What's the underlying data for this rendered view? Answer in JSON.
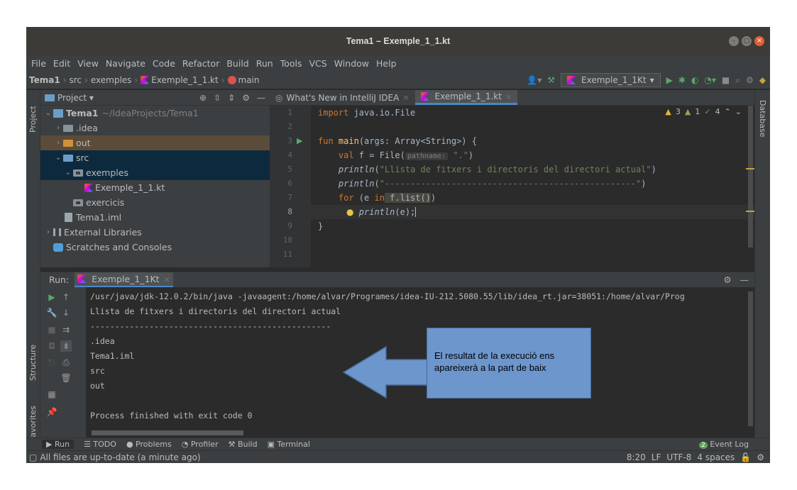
{
  "window": {
    "title": "Tema1 – Exemple_1_1.kt"
  },
  "menu": [
    "File",
    "Edit",
    "View",
    "Navigate",
    "Code",
    "Refactor",
    "Build",
    "Run",
    "Tools",
    "VCS",
    "Window",
    "Help"
  ],
  "breadcrumb": [
    "Tema1",
    "src",
    "exemples",
    "Exemple_1_1.kt",
    "main"
  ],
  "toolbar": {
    "run_config": "Exemple_1_1Kt"
  },
  "left_strip": {
    "project": "Project",
    "structure": "Structure",
    "favorites": "Favorites"
  },
  "right_strip": {
    "database": "Database"
  },
  "project_panel": {
    "title": "Project",
    "tree": [
      {
        "label": "Tema1",
        "suffix": "~/IdeaProjects/Tema1"
      },
      {
        "label": ".idea"
      },
      {
        "label": "out"
      },
      {
        "label": "src"
      },
      {
        "label": "exemples"
      },
      {
        "label": "Exemple_1_1.kt"
      },
      {
        "label": "exercicis"
      },
      {
        "label": "Tema1.iml"
      },
      {
        "label": "External Libraries"
      },
      {
        "label": "Scratches and Consoles"
      }
    ]
  },
  "editor": {
    "tabs": [
      {
        "label": "What's New in IntelliJ IDEA"
      },
      {
        "label": "Exemple_1_1.kt"
      }
    ],
    "inspections": {
      "warn_a": "3",
      "warn_b": "1",
      "typo": "4"
    },
    "line_numbers": [
      "1",
      "2",
      "3",
      "4",
      "5",
      "6",
      "7",
      "8",
      "9",
      "10",
      "11"
    ],
    "code": {
      "l1_kw": "import",
      "l1_rest": " java.io.File",
      "l3_kw": "fun",
      "l3_fn": " main",
      "l3_rest": "(args: Array<String>) {",
      "l4_kw": "    val",
      "l4_a": " f = File(",
      "l4_hint": "pathname:",
      "l4_str": " \".\"",
      "l4_b": ")",
      "l5_fn": "    println",
      "l5_a": "(",
      "l5_str": "\"Llista de fitxers i directoris del directori actual\"",
      "l5_b": ")",
      "l6_fn": "    println",
      "l6_a": "(",
      "l6_str": "\"-------------------------------------------------\"",
      "l6_b": ")",
      "l7_kw": "    for",
      "l7_a": " (e ",
      "l7_kw2": "in",
      "l7_hl": " f.list()",
      "l7_b": ")",
      "l8_fn": "        println",
      "l8_a": "(e);",
      "l9": "}"
    }
  },
  "run_panel": {
    "label": "Run:",
    "tab": "Exemple_1_1Kt",
    "output": [
      "/usr/java/jdk-12.0.2/bin/java -javaagent:/home/alvar/Programes/idea-IU-212.5080.55/lib/idea_rt.jar=38051:/home/alvar/Prog",
      "Llista de fitxers i directoris del directori actual",
      "-------------------------------------------------",
      ".idea",
      "Tema1.iml",
      "src",
      "out",
      "",
      "Process finished with exit code 0"
    ]
  },
  "tool_windows": [
    "Run",
    "TODO",
    "Problems",
    "Profiler",
    "Build",
    "Terminal"
  ],
  "event_log": {
    "count": "2",
    "label": "Event Log"
  },
  "status": {
    "message": "All files are up-to-date (a minute ago)",
    "position": "8:20",
    "line_sep": "LF",
    "encoding": "UTF-8",
    "indent": "4 spaces"
  },
  "annotation": {
    "text": "El resultat de la execució ens apareixerà a la part de baix"
  },
  "colors": {
    "accent": "#4a88c7",
    "callout": "#6d96cd",
    "keyword": "#cc7832",
    "string": "#6a8759"
  }
}
